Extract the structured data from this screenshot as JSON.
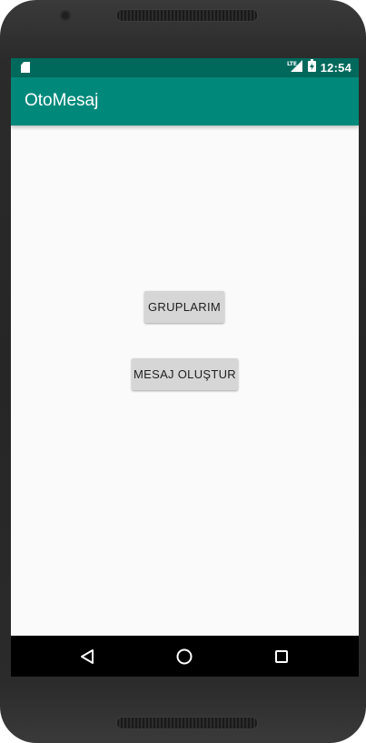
{
  "status_bar": {
    "time": "12:54",
    "network": "LTE",
    "icons": [
      "sd-card-icon",
      "lte-signal-icon",
      "battery-charging-icon"
    ]
  },
  "app_bar": {
    "title": "OtoMesaj"
  },
  "main": {
    "buttons": [
      {
        "label": "GRUPLARIM"
      },
      {
        "label": "MESAJ OLUŞTUR"
      }
    ]
  },
  "nav_bar": {
    "icons": [
      "back-icon",
      "home-icon",
      "recent-apps-icon"
    ]
  },
  "colors": {
    "status_bar": "#00695c",
    "app_bar": "#00897b",
    "background": "#fafafa",
    "button": "#d6d6d6"
  }
}
